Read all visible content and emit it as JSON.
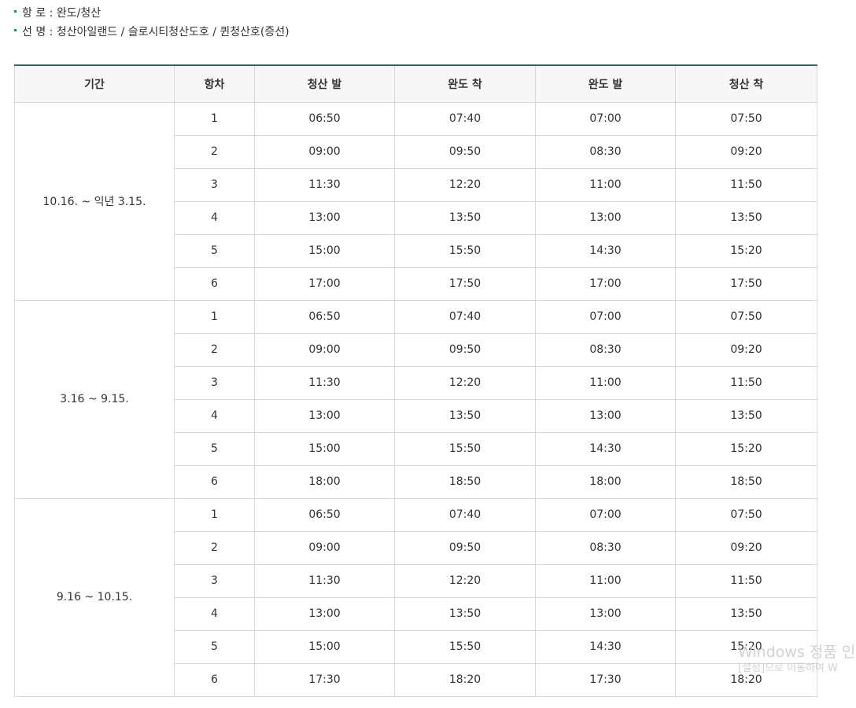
{
  "info": [
    {
      "label": "항 로 :",
      "value": "완도/청산"
    },
    {
      "label": "선 명 :",
      "value": "청산아일랜드 / 슬로시티청산도호 / 퀸청산호(증선)"
    }
  ],
  "table": {
    "headers": [
      "기간",
      "항차",
      "청산 발",
      "완도 착",
      "완도 발",
      "청산 착"
    ],
    "periods": [
      {
        "period": "10.16. ~ 익년 3.15.",
        "rows": [
          [
            "1",
            "06:50",
            "07:40",
            "07:00",
            "07:50"
          ],
          [
            "2",
            "09:00",
            "09:50",
            "08:30",
            "09:20"
          ],
          [
            "3",
            "11:30",
            "12:20",
            "11:00",
            "11:50"
          ],
          [
            "4",
            "13:00",
            "13:50",
            "13:00",
            "13:50"
          ],
          [
            "5",
            "15:00",
            "15:50",
            "14:30",
            "15:20"
          ],
          [
            "6",
            "17:00",
            "17:50",
            "17:00",
            "17:50"
          ]
        ]
      },
      {
        "period": "3.16 ~ 9.15.",
        "rows": [
          [
            "1",
            "06:50",
            "07:40",
            "07:00",
            "07:50"
          ],
          [
            "2",
            "09:00",
            "09:50",
            "08:30",
            "09:20"
          ],
          [
            "3",
            "11:30",
            "12:20",
            "11:00",
            "11:50"
          ],
          [
            "4",
            "13:00",
            "13:50",
            "13:00",
            "13:50"
          ],
          [
            "5",
            "15:00",
            "15:50",
            "14:30",
            "15:20"
          ],
          [
            "6",
            "18:00",
            "18:50",
            "18:00",
            "18:50"
          ]
        ]
      },
      {
        "period": "9.16 ~ 10.15.",
        "rows": [
          [
            "1",
            "06:50",
            "07:40",
            "07:00",
            "07:50"
          ],
          [
            "2",
            "09:00",
            "09:50",
            "08:30",
            "09:20"
          ],
          [
            "3",
            "11:30",
            "12:20",
            "11:00",
            "11:50"
          ],
          [
            "4",
            "13:00",
            "13:50",
            "13:00",
            "13:50"
          ],
          [
            "5",
            "15:00",
            "15:50",
            "14:30",
            "15:20"
          ],
          [
            "6",
            "17:30",
            "18:20",
            "17:30",
            "18:20"
          ]
        ]
      }
    ]
  },
  "watermark": {
    "title": "Windows 정품 인",
    "subtitle": "[설정]으로 이동하여 W"
  },
  "colors": {
    "bullet": "#1a8a6e",
    "header_top_border": "#2e6b5e",
    "header_bg": "#f7f7f7",
    "border": "#d8d8d8"
  }
}
